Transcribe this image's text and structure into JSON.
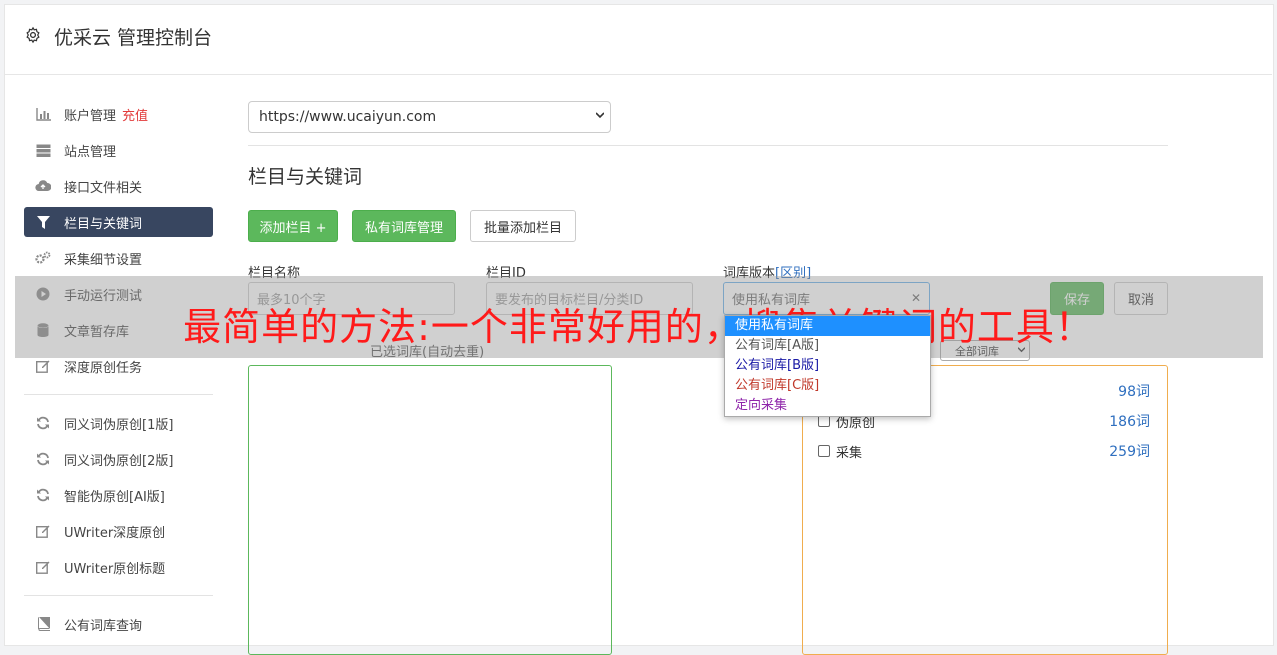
{
  "header": {
    "title": "优采云 管理控制台",
    "icon": "gear-icon"
  },
  "sidebar": {
    "items": [
      {
        "label": "账户管理",
        "extra": "充值",
        "icon": "bar-chart-icon"
      },
      {
        "label": "站点管理",
        "icon": "server-icon"
      },
      {
        "label": "接口文件相关",
        "icon": "cloud-upload-icon"
      },
      {
        "label": "栏目与关键词",
        "icon": "filter-icon",
        "active": true
      },
      {
        "label": "采集细节设置",
        "icon": "gears-icon"
      },
      {
        "label": "手动运行测试",
        "icon": "play-circle-icon"
      },
      {
        "label": "文章暂存库",
        "icon": "database-icon"
      },
      {
        "label": "深度原创任务",
        "icon": "edit-icon"
      },
      {
        "label": "同义词伪原创[1版]",
        "icon": "refresh-icon"
      },
      {
        "label": "同义词伪原创[2版]",
        "icon": "refresh-icon"
      },
      {
        "label": "智能伪原创[AI版]",
        "icon": "refresh-icon"
      },
      {
        "label": "UWriter深度原创",
        "icon": "edit-icon"
      },
      {
        "label": "UWriter原创标题",
        "icon": "edit-icon"
      },
      {
        "label": "公有词库查询",
        "icon": "book-icon"
      }
    ]
  },
  "main": {
    "site_select": "https://www.ucaiyun.com",
    "section_title": "栏目与关键词",
    "buttons": {
      "add_column": "添加栏目 +",
      "private_lib": "私有词库管理",
      "batch_add": "批量添加栏目"
    },
    "form": {
      "name_label": "栏目名称",
      "name_placeholder": "最多10个字",
      "id_label": "栏目ID",
      "id_placeholder": "要发布的目标栏目/分类ID",
      "version_label": "词库版本",
      "version_link": "[区别]",
      "version_value": "使用私有词库",
      "save": "保存",
      "cancel": "取消"
    },
    "dropdown_options": [
      {
        "label": "使用私有词库",
        "color": "#ffffff",
        "selected": true
      },
      {
        "label": "公有词库[A版]",
        "color": "#555555"
      },
      {
        "label": "公有词库[B版]",
        "color": "#1a1aa6"
      },
      {
        "label": "公有词库[C版]",
        "color": "#c0392b"
      },
      {
        "label": "定向采集",
        "color": "#8e24aa"
      }
    ],
    "selected_libs_label": "已选词库(自动去重)",
    "lib_filter": "全部词库",
    "libs": [
      {
        "name": "",
        "count": "98词"
      },
      {
        "name": "伪原创",
        "count": "186词"
      },
      {
        "name": "采集",
        "count": "259词"
      }
    ]
  },
  "overlay": {
    "text": "最简单的方法:一个非常好用的，搜集关键词的工具！"
  }
}
